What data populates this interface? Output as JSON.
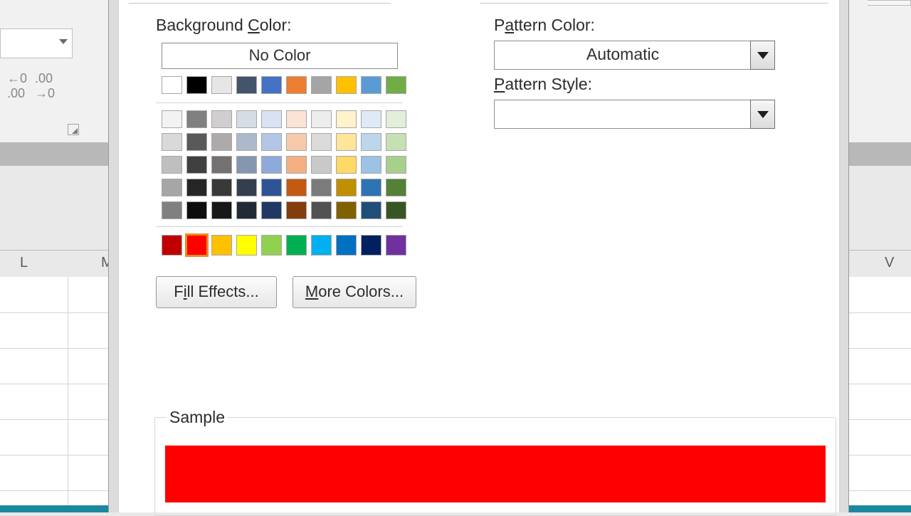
{
  "labels": {
    "background_color": "Background Color:",
    "background_color_pre": "Background ",
    "background_color_key": "C",
    "background_color_post": "olor:",
    "pattern_color": "Pattern Color:",
    "pattern_color_pre": "P",
    "pattern_color_key": "a",
    "pattern_color_post": "ttern Color:",
    "pattern_style": "Pattern Style:",
    "pattern_style_pre": "",
    "pattern_style_key": "P",
    "pattern_style_post": "attern Style:",
    "no_color": "No Color",
    "fill_effects": "Fill Effects...",
    "fill_effects_pre": "F",
    "fill_effects_key": "i",
    "fill_effects_post": "ll Effects...",
    "more_colors": "More Colors...",
    "more_colors_pre": "",
    "more_colors_key": "M",
    "more_colors_post": "ore Colors...",
    "sample": "Sample"
  },
  "pattern_color_value": "Automatic",
  "pattern_style_value": "",
  "theme_row1": [
    "#ffffff",
    "#000000",
    "#e7e6e6",
    "#44546a",
    "#4472c4",
    "#ed7d31",
    "#a5a5a5",
    "#ffc000",
    "#5b9bd5",
    "#70ad47"
  ],
  "theme_tints": [
    [
      "#f2f2f2",
      "#808080",
      "#d0cece",
      "#d6dce4",
      "#d9e2f3",
      "#fbe4d5",
      "#ededed",
      "#fff2cc",
      "#deeaf6",
      "#e2efd9"
    ],
    [
      "#d9d9d9",
      "#595959",
      "#aeaaaa",
      "#adb9ca",
      "#b4c6e7",
      "#f7caac",
      "#dbdbdb",
      "#ffe599",
      "#bdd6ee",
      "#c5e0b3"
    ],
    [
      "#bfbfbf",
      "#404040",
      "#767171",
      "#8496b0",
      "#8eaadb",
      "#f4b083",
      "#c9c9c9",
      "#ffd966",
      "#9cc2e5",
      "#a8d08d"
    ],
    [
      "#a6a6a6",
      "#262626",
      "#3b3838",
      "#333f4f",
      "#2f5496",
      "#c45911",
      "#7b7b7b",
      "#bf8f00",
      "#2e74b5",
      "#538135"
    ],
    [
      "#808080",
      "#0d0d0d",
      "#171717",
      "#222a35",
      "#1f3864",
      "#833c0b",
      "#525252",
      "#806000",
      "#1f4e79",
      "#385623"
    ]
  ],
  "standard_colors": [
    "#c00000",
    "#ff0000",
    "#ffc000",
    "#ffff00",
    "#92d050",
    "#00b050",
    "#00b0f0",
    "#0070c0",
    "#002060",
    "#7030a0"
  ],
  "selected_standard_index": 1,
  "sample_color": "#ff0000",
  "bg_columns": {
    "L": 35,
    "M": 150,
    "V": 1250
  }
}
